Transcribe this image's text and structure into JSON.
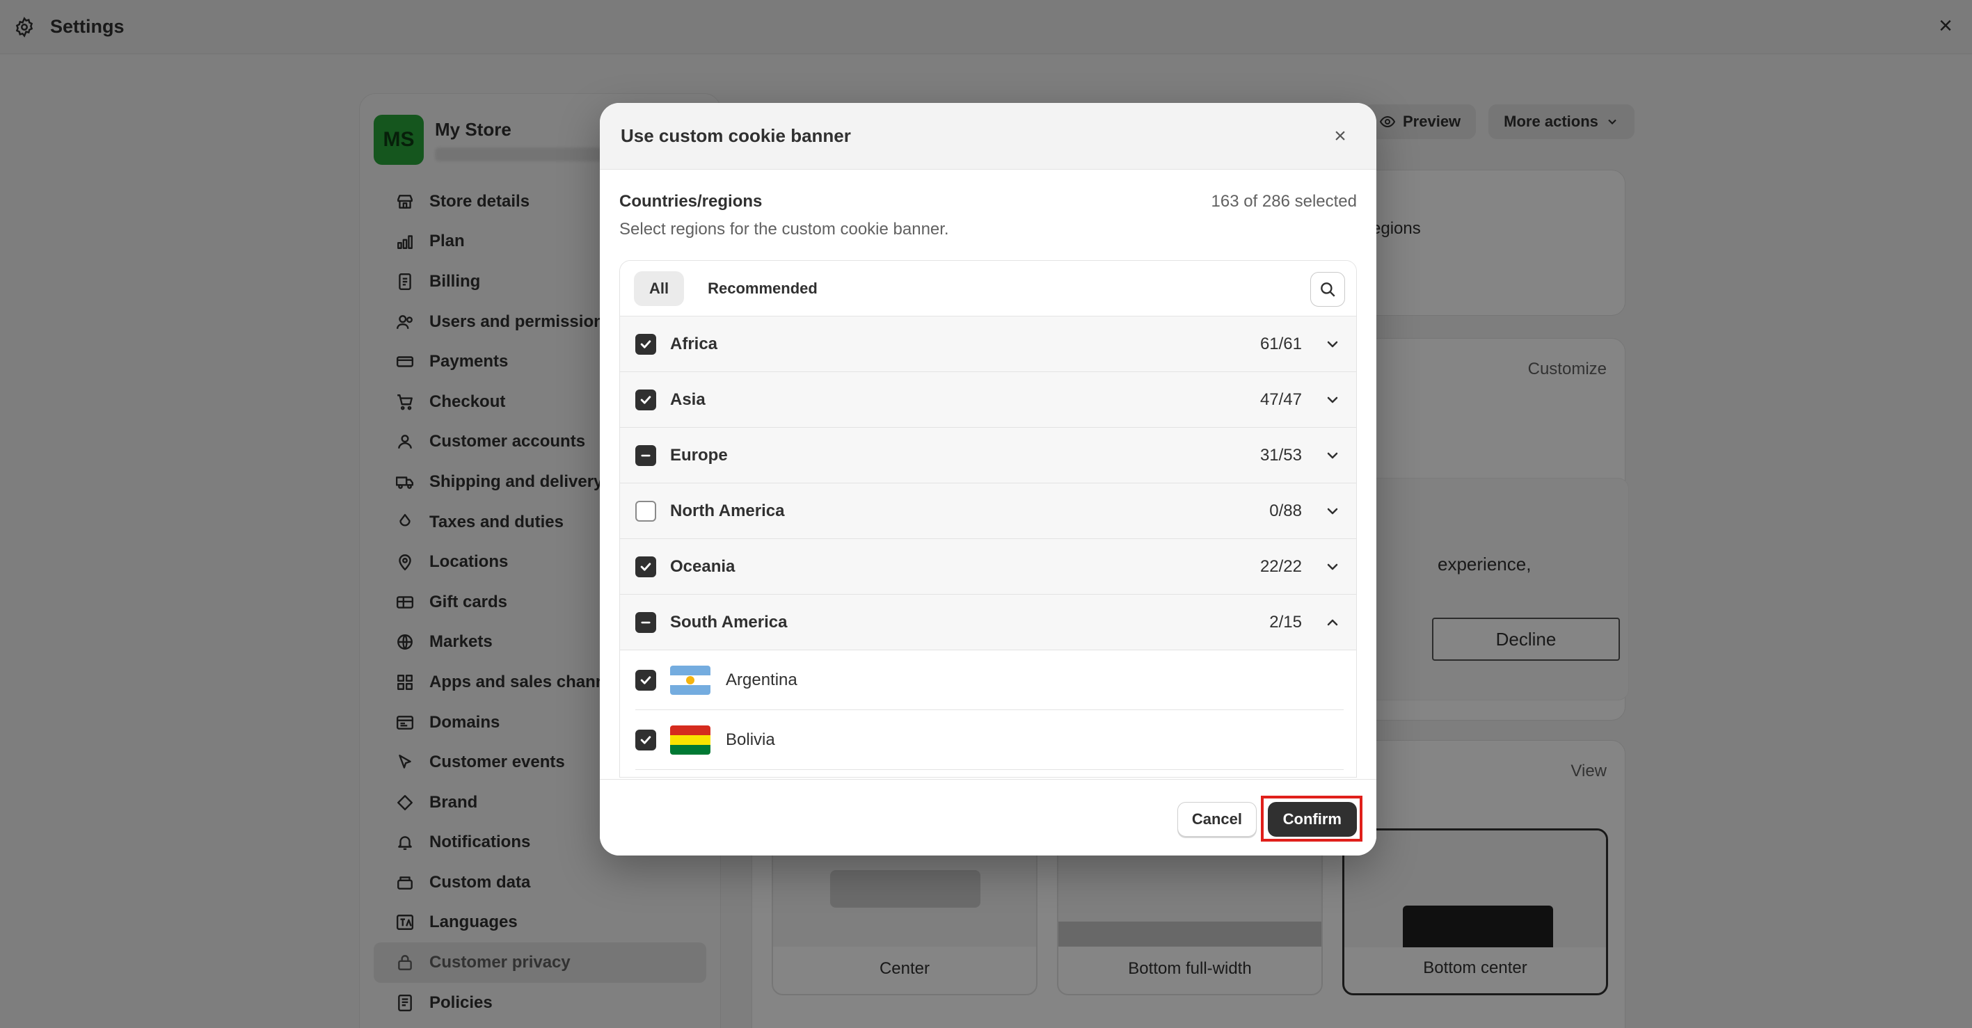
{
  "window": {
    "title": "Settings"
  },
  "store": {
    "initials": "MS",
    "name": "My Store"
  },
  "nav": {
    "items": [
      {
        "label": "Store details",
        "icon": "store-icon"
      },
      {
        "label": "Plan",
        "icon": "plan-icon"
      },
      {
        "label": "Billing",
        "icon": "billing-icon"
      },
      {
        "label": "Users and permissions",
        "icon": "users-icon"
      },
      {
        "label": "Payments",
        "icon": "payments-icon"
      },
      {
        "label": "Checkout",
        "icon": "cart-icon"
      },
      {
        "label": "Customer accounts",
        "icon": "person-icon"
      },
      {
        "label": "Shipping and delivery",
        "icon": "truck-icon"
      },
      {
        "label": "Taxes and duties",
        "icon": "tax-icon"
      },
      {
        "label": "Locations",
        "icon": "location-icon"
      },
      {
        "label": "Gift cards",
        "icon": "gift-card-icon"
      },
      {
        "label": "Markets",
        "icon": "globe-icon"
      },
      {
        "label": "Apps and sales channels",
        "icon": "apps-icon"
      },
      {
        "label": "Domains",
        "icon": "domain-icon"
      },
      {
        "label": "Customer events",
        "icon": "cursor-icon"
      },
      {
        "label": "Brand",
        "icon": "brand-icon"
      },
      {
        "label": "Notifications",
        "icon": "bell-icon"
      },
      {
        "label": "Custom data",
        "icon": "data-icon"
      },
      {
        "label": "Languages",
        "icon": "language-icon"
      },
      {
        "label": "Customer privacy",
        "icon": "lock-icon"
      },
      {
        "label": "Policies",
        "icon": "policy-icon"
      }
    ],
    "active_index": 19
  },
  "background": {
    "preview_label": "Preview",
    "more_actions_label": "More actions",
    "regions_fragment": "egions",
    "customize_label": "Customize",
    "experience_fragment": "experience,",
    "decline_label": "Decline",
    "view_label": "View",
    "positions": [
      "Center",
      "Bottom full-width",
      "Bottom center"
    ]
  },
  "modal": {
    "title": "Use custom cookie banner",
    "section_title": "Countries/regions",
    "selected_count": "163 of 286 selected",
    "description": "Select regions for the custom cookie banner.",
    "tabs": [
      "All",
      "Recommended"
    ],
    "regions": [
      {
        "name": "Africa",
        "count": "61/61",
        "state": "checked",
        "expanded": false
      },
      {
        "name": "Asia",
        "count": "47/47",
        "state": "checked",
        "expanded": false
      },
      {
        "name": "Europe",
        "count": "31/53",
        "state": "indeterminate",
        "expanded": false
      },
      {
        "name": "North America",
        "count": "0/88",
        "state": "unchecked",
        "expanded": false
      },
      {
        "name": "Oceania",
        "count": "22/22",
        "state": "checked",
        "expanded": false
      },
      {
        "name": "South America",
        "count": "2/15",
        "state": "indeterminate",
        "expanded": true
      }
    ],
    "countries": [
      {
        "name": "Argentina",
        "checked": true,
        "flag": "argentina-flag-icon"
      },
      {
        "name": "Bolivia",
        "checked": true,
        "flag": "bolivia-flag-icon"
      }
    ],
    "cancel_label": "Cancel",
    "confirm_label": "Confirm"
  },
  "colors": {
    "primary_button": "#303030",
    "highlight": "#e0201b",
    "avatar": "#29a63a"
  }
}
